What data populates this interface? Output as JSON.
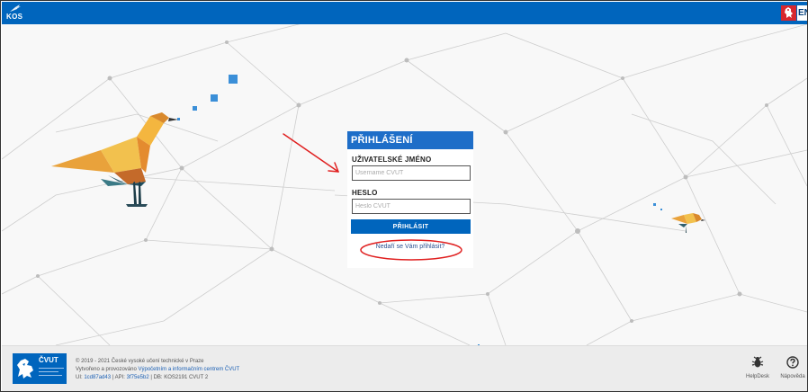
{
  "header": {
    "logo_text": "KOS",
    "lang_label": "EN"
  },
  "login": {
    "title": "PŘIHLÁŠENÍ",
    "username_label": "UŽIVATELSKÉ JMÉNO",
    "username_placeholder": "Username ČVUT",
    "password_label": "HESLO",
    "password_placeholder": "Heslo ČVUT",
    "submit_label": "PŘIHLÁSIT",
    "help_link": "Nedaří se Vám přihlásit?"
  },
  "footer": {
    "logo_name": "ČVUT",
    "copyright": "© 2019 - 2021 České vysoké učení technické v Praze",
    "operated_prefix": "Vytvořeno a provozováno",
    "operated_link": "Výpočetním a informačním centrem ČVUT",
    "build_ui_label": "UI:",
    "build_ui_value": "1cd87ad43",
    "build_api_label": "API:",
    "build_api_value": "3f75e5b2",
    "build_db_label": "DB:",
    "build_db_value": "KOS2191 CVUT 2",
    "helpdesk_label": "HelpDesk",
    "help_label": "Nápověda"
  },
  "colors": {
    "brand_blue": "#0065bd",
    "panel_header_blue": "#1e6ec8",
    "annotation_red": "#e02020",
    "flag_red": "#d7282f"
  },
  "icons": {
    "logo": "kos-bird-icon",
    "lang": "czech-lion-flag-icon",
    "helpdesk": "bug-icon",
    "help": "question-circle-icon"
  }
}
